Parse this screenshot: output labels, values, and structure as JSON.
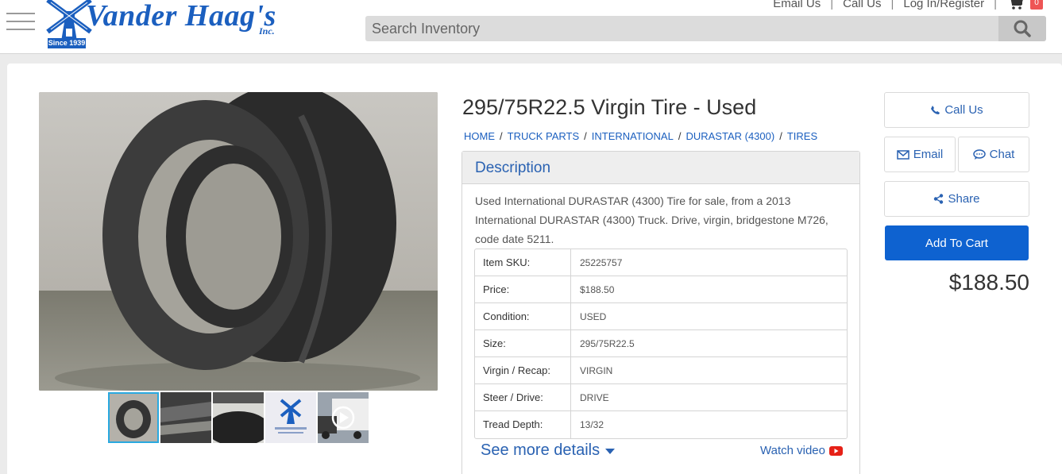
{
  "header": {
    "logo": {
      "name": "Vander Haag's",
      "inc": "Inc.",
      "since": "Since 1939"
    },
    "links": {
      "email": "Email Us",
      "call": "Call Us",
      "login": "Log In/Register"
    },
    "cart": {
      "count": "0"
    },
    "search": {
      "placeholder": "Search Inventory",
      "value": ""
    }
  },
  "product": {
    "title": "295/75R22.5 Virgin Tire - Used",
    "breadcrumb": [
      "HOME",
      "TRUCK PARTS",
      "INTERNATIONAL",
      "DURASTAR (4300)",
      "TIRES"
    ],
    "description_heading": "Description",
    "description": "Used International DURASTAR (4300) Tire for sale, from a 2013 International DURASTAR (4300) Truck. Drive, virgin, bridgestone M726, code date 5211.",
    "specs": [
      {
        "label": "Item SKU:",
        "value": "25225757"
      },
      {
        "label": "Price:",
        "value": "$188.50"
      },
      {
        "label": "Condition:",
        "value": "USED"
      },
      {
        "label": "Size:",
        "value": "295/75R22.5"
      },
      {
        "label": "Virgin / Recap:",
        "value": "VIRGIN"
      },
      {
        "label": "Steer / Drive:",
        "value": "DRIVE"
      },
      {
        "label": "Tread Depth:",
        "value": "13/32"
      }
    ],
    "see_more": "See more details",
    "watch_video": "Watch video"
  },
  "actions": {
    "call": "Call Us",
    "email": "Email",
    "chat": "Chat",
    "share": "Share",
    "add_to_cart": "Add To Cart",
    "price": "$188.50"
  },
  "colors": {
    "brand_blue": "#1b5fbf",
    "link_blue": "#2a62b2",
    "cart_button": "#0e62d0",
    "thumb_active": "#2aa9e0",
    "youtube_red": "#e62117"
  },
  "icons": [
    "menu-icon",
    "windmill-logo-icon",
    "cart-icon",
    "search-icon",
    "phone-icon",
    "envelope-icon",
    "chat-icon",
    "share-icon",
    "caret-down-icon",
    "youtube-icon",
    "play-icon"
  ]
}
